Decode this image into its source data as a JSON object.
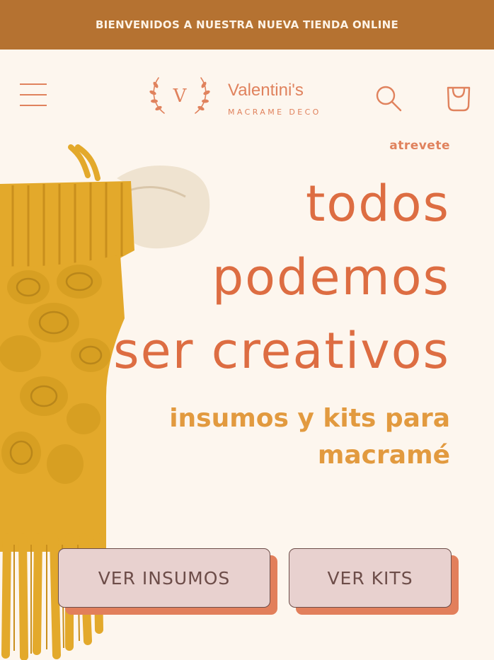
{
  "announcement": {
    "text": "BIENVENIDOS A NUESTRA NUEVA TIENDA ONLINE"
  },
  "header": {
    "logo_mark": "V",
    "logo_title": "Valentini's",
    "logo_subtitle": "MACRAME DECO",
    "menu_icon": "hamburger-menu-icon",
    "search_icon": "search-icon",
    "cart_icon": "cart-bag-icon"
  },
  "hero": {
    "eyebrow": "atrevete",
    "headline": [
      "todos",
      "podemos",
      "ser creativos"
    ],
    "subheadline": [
      "insumos y kits para",
      "macramé"
    ],
    "buttons": [
      {
        "label": "VER INSUMOS"
      },
      {
        "label": "VER KITS"
      }
    ]
  },
  "colors": {
    "announcement_bg": "#b57231",
    "page_bg": "#fdf6ee",
    "accent": "#e0825d",
    "headline": "#dd6d42",
    "subheadline": "#e29a3f",
    "button_bg": "#e8d1cf",
    "button_shadow": "#e27f5b",
    "macrame_yarn": "#e3a92b"
  }
}
